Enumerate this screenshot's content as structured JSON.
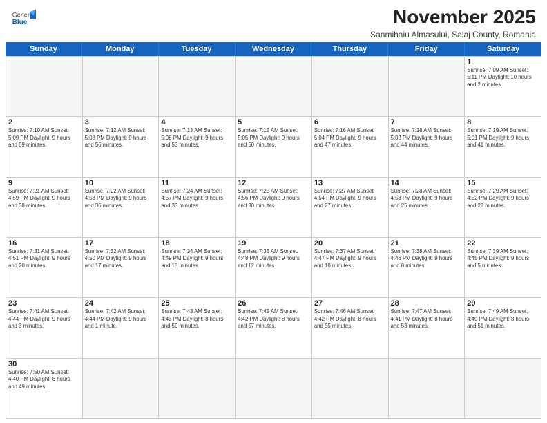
{
  "logo": {
    "general": "General",
    "blue": "Blue"
  },
  "header": {
    "month_title": "November 2025",
    "subtitle": "Sanmihaiu Almasului, Salaj County, Romania"
  },
  "day_headers": [
    "Sunday",
    "Monday",
    "Tuesday",
    "Wednesday",
    "Thursday",
    "Friday",
    "Saturday"
  ],
  "weeks": [
    [
      {
        "num": "",
        "info": "",
        "empty": true
      },
      {
        "num": "",
        "info": "",
        "empty": true
      },
      {
        "num": "",
        "info": "",
        "empty": true
      },
      {
        "num": "",
        "info": "",
        "empty": true
      },
      {
        "num": "",
        "info": "",
        "empty": true
      },
      {
        "num": "",
        "info": "",
        "empty": true
      },
      {
        "num": "1",
        "info": "Sunrise: 7:09 AM\nSunset: 5:11 PM\nDaylight: 10 hours\nand 2 minutes.",
        "empty": false
      }
    ],
    [
      {
        "num": "2",
        "info": "Sunrise: 7:10 AM\nSunset: 5:09 PM\nDaylight: 9 hours\nand 59 minutes.",
        "empty": false
      },
      {
        "num": "3",
        "info": "Sunrise: 7:12 AM\nSunset: 5:08 PM\nDaylight: 9 hours\nand 56 minutes.",
        "empty": false
      },
      {
        "num": "4",
        "info": "Sunrise: 7:13 AM\nSunset: 5:06 PM\nDaylight: 9 hours\nand 53 minutes.",
        "empty": false
      },
      {
        "num": "5",
        "info": "Sunrise: 7:15 AM\nSunset: 5:05 PM\nDaylight: 9 hours\nand 50 minutes.",
        "empty": false
      },
      {
        "num": "6",
        "info": "Sunrise: 7:16 AM\nSunset: 5:04 PM\nDaylight: 9 hours\nand 47 minutes.",
        "empty": false
      },
      {
        "num": "7",
        "info": "Sunrise: 7:18 AM\nSunset: 5:02 PM\nDaylight: 9 hours\nand 44 minutes.",
        "empty": false
      },
      {
        "num": "8",
        "info": "Sunrise: 7:19 AM\nSunset: 5:01 PM\nDaylight: 9 hours\nand 41 minutes.",
        "empty": false
      }
    ],
    [
      {
        "num": "9",
        "info": "Sunrise: 7:21 AM\nSunset: 4:59 PM\nDaylight: 9 hours\nand 38 minutes.",
        "empty": false
      },
      {
        "num": "10",
        "info": "Sunrise: 7:22 AM\nSunset: 4:58 PM\nDaylight: 9 hours\nand 36 minutes.",
        "empty": false
      },
      {
        "num": "11",
        "info": "Sunrise: 7:24 AM\nSunset: 4:57 PM\nDaylight: 9 hours\nand 33 minutes.",
        "empty": false
      },
      {
        "num": "12",
        "info": "Sunrise: 7:25 AM\nSunset: 4:56 PM\nDaylight: 9 hours\nand 30 minutes.",
        "empty": false
      },
      {
        "num": "13",
        "info": "Sunrise: 7:27 AM\nSunset: 4:54 PM\nDaylight: 9 hours\nand 27 minutes.",
        "empty": false
      },
      {
        "num": "14",
        "info": "Sunrise: 7:28 AM\nSunset: 4:53 PM\nDaylight: 9 hours\nand 25 minutes.",
        "empty": false
      },
      {
        "num": "15",
        "info": "Sunrise: 7:29 AM\nSunset: 4:52 PM\nDaylight: 9 hours\nand 22 minutes.",
        "empty": false
      }
    ],
    [
      {
        "num": "16",
        "info": "Sunrise: 7:31 AM\nSunset: 4:51 PM\nDaylight: 9 hours\nand 20 minutes.",
        "empty": false
      },
      {
        "num": "17",
        "info": "Sunrise: 7:32 AM\nSunset: 4:50 PM\nDaylight: 9 hours\nand 17 minutes.",
        "empty": false
      },
      {
        "num": "18",
        "info": "Sunrise: 7:34 AM\nSunset: 4:49 PM\nDaylight: 9 hours\nand 15 minutes.",
        "empty": false
      },
      {
        "num": "19",
        "info": "Sunrise: 7:35 AM\nSunset: 4:48 PM\nDaylight: 9 hours\nand 12 minutes.",
        "empty": false
      },
      {
        "num": "20",
        "info": "Sunrise: 7:37 AM\nSunset: 4:47 PM\nDaylight: 9 hours\nand 10 minutes.",
        "empty": false
      },
      {
        "num": "21",
        "info": "Sunrise: 7:38 AM\nSunset: 4:46 PM\nDaylight: 9 hours\nand 8 minutes.",
        "empty": false
      },
      {
        "num": "22",
        "info": "Sunrise: 7:39 AM\nSunset: 4:45 PM\nDaylight: 9 hours\nand 5 minutes.",
        "empty": false
      }
    ],
    [
      {
        "num": "23",
        "info": "Sunrise: 7:41 AM\nSunset: 4:44 PM\nDaylight: 9 hours\nand 3 minutes.",
        "empty": false
      },
      {
        "num": "24",
        "info": "Sunrise: 7:42 AM\nSunset: 4:44 PM\nDaylight: 9 hours\nand 1 minute.",
        "empty": false
      },
      {
        "num": "25",
        "info": "Sunrise: 7:43 AM\nSunset: 4:43 PM\nDaylight: 8 hours\nand 59 minutes.",
        "empty": false
      },
      {
        "num": "26",
        "info": "Sunrise: 7:45 AM\nSunset: 4:42 PM\nDaylight: 8 hours\nand 57 minutes.",
        "empty": false
      },
      {
        "num": "27",
        "info": "Sunrise: 7:46 AM\nSunset: 4:42 PM\nDaylight: 8 hours\nand 55 minutes.",
        "empty": false
      },
      {
        "num": "28",
        "info": "Sunrise: 7:47 AM\nSunset: 4:41 PM\nDaylight: 8 hours\nand 53 minutes.",
        "empty": false
      },
      {
        "num": "29",
        "info": "Sunrise: 7:49 AM\nSunset: 4:40 PM\nDaylight: 8 hours\nand 51 minutes.",
        "empty": false
      }
    ],
    [
      {
        "num": "30",
        "info": "Sunrise: 7:50 AM\nSunset: 4:40 PM\nDaylight: 8 hours\nand 49 minutes.",
        "empty": false
      },
      {
        "num": "",
        "info": "",
        "empty": true
      },
      {
        "num": "",
        "info": "",
        "empty": true
      },
      {
        "num": "",
        "info": "",
        "empty": true
      },
      {
        "num": "",
        "info": "",
        "empty": true
      },
      {
        "num": "",
        "info": "",
        "empty": true
      },
      {
        "num": "",
        "info": "",
        "empty": true
      }
    ]
  ]
}
